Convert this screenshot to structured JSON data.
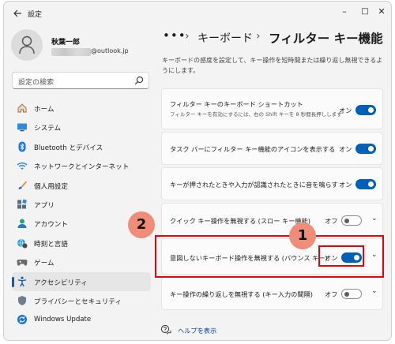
{
  "window": {
    "title": "設定",
    "back_icon": "arrow-left-icon",
    "controls": {
      "minimize": "–",
      "maximize": "□",
      "close": "✕"
    }
  },
  "profile": {
    "name": "秋葉一郎",
    "email_domain": "@outlook.jp",
    "avatar_icon": "person-icon"
  },
  "search": {
    "placeholder": "設定の検索",
    "icon": "search-icon"
  },
  "nav": {
    "items": [
      {
        "label": "ホーム",
        "icon": "home-icon"
      },
      {
        "label": "システム",
        "icon": "monitor-icon"
      },
      {
        "label": "Bluetooth とデバイス",
        "icon": "bluetooth-icon"
      },
      {
        "label": "ネットワークとインターネット",
        "icon": "wifi-icon"
      },
      {
        "label": "個人用設定",
        "icon": "brush-icon"
      },
      {
        "label": "アプリ",
        "icon": "apps-icon"
      },
      {
        "label": "アカウント",
        "icon": "account-icon"
      },
      {
        "label": "時刻と言語",
        "icon": "globe-clock-icon"
      },
      {
        "label": "ゲーム",
        "icon": "gamepad-icon"
      },
      {
        "label": "アクセシビリティ",
        "icon": "accessibility-icon"
      },
      {
        "label": "プライバシーとセキュリティ",
        "icon": "shield-icon"
      },
      {
        "label": "Windows Update",
        "icon": "update-icon"
      }
    ],
    "active_index": 9
  },
  "breadcrumb": {
    "ellipsis": "•••",
    "separator": "›",
    "parent": "キーボード",
    "current": "フィルター キー機能"
  },
  "description": "キーボードの感度を設定して、キー操作を短時間または繰り返し無視できるようにします。",
  "settings": [
    {
      "title": "フィルター キーのキーボード ショートカット",
      "subtitle": "フィルター キーを有効にするには、右の Shift キーを 8 秒間長押しします",
      "state": "オン",
      "on": true
    },
    {
      "title": "タスク バーにフィルター キー機能のアイコンを表示する",
      "state": "オン",
      "on": true
    },
    {
      "title": "キーが押されたときや入力が認識されたときに音を鳴らす",
      "state": "オン",
      "on": true
    },
    {
      "title": "クイック キー操作を無視する (スロー キー機能)",
      "state": "オフ",
      "on": false,
      "expandable": true
    },
    {
      "title": "意図しないキーボード操作を無視する (バウンス キー)",
      "state": "オン",
      "on": true,
      "expandable": true
    },
    {
      "title": "キー操作の繰り返しを無視する (キー入力の間隔)",
      "state": "オフ",
      "on": false,
      "expandable": true
    }
  ],
  "annotations": {
    "step1": "1",
    "step2": "2",
    "highlight_color": "#e8000b",
    "badge_color": "#ef8d7a"
  },
  "help": {
    "label": "ヘルプを表示",
    "icon": "help-chat-icon"
  },
  "colors": {
    "accent": "#005fb8",
    "background": "#f3f3f3",
    "card": "#fbfbfb"
  }
}
